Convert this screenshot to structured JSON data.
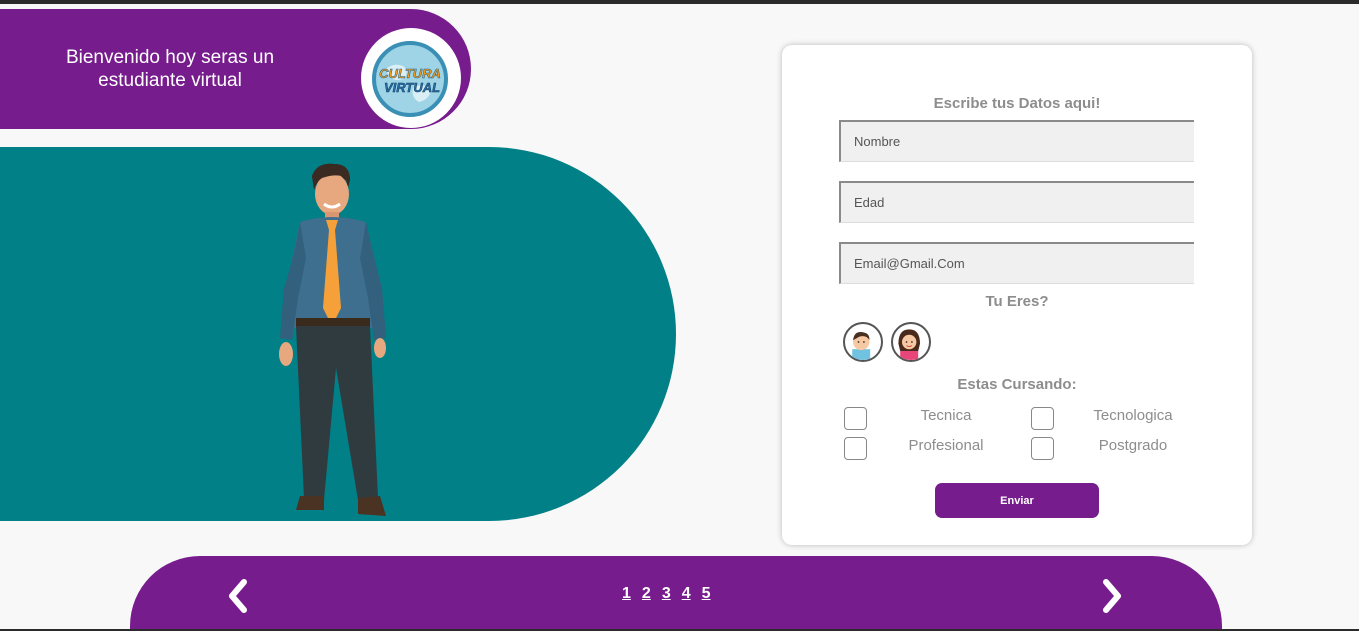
{
  "header": {
    "welcome_line1": "Bienvenido hoy seras un",
    "welcome_line2": "estudiante virtual",
    "logo_word1": "CULTURA",
    "logo_word2": "VIRTUAL"
  },
  "form": {
    "title": "Escribe tus Datos aqui!",
    "name_placeholder": "Nombre",
    "age_placeholder": "Edad",
    "email_placeholder": "Email@Gmail.Com",
    "gender_question": "Tu Eres?",
    "gender_options": [
      "boy-avatar-icon",
      "girl-avatar-icon"
    ],
    "studies_question": "Estas Cursando:",
    "studies_options": [
      "Tecnica",
      "Tecnologica",
      "Profesional",
      "Postgrado"
    ],
    "submit_label": "Enviar"
  },
  "footer": {
    "prev_icon": "chevron-left-icon",
    "next_icon": "chevron-right-icon",
    "pages": [
      "1",
      "2",
      "3",
      "4",
      "5"
    ]
  },
  "colors": {
    "brand_purple": "#771c8c",
    "teal": "#018087",
    "background": "#f8f8f8"
  }
}
